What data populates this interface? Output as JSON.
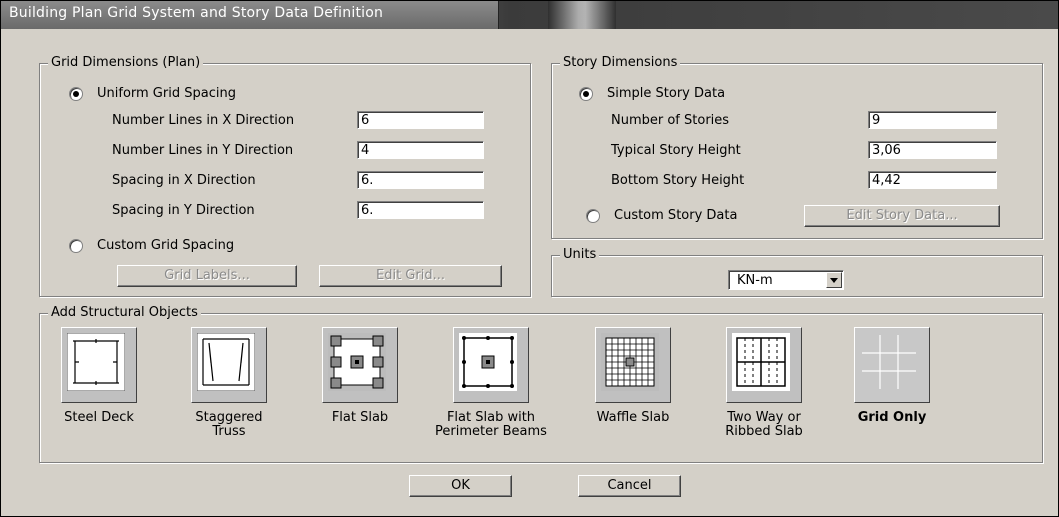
{
  "window": {
    "title": "Building Plan Grid System and Story Data Definition"
  },
  "grid": {
    "group_title": "Grid Dimensions (Plan)",
    "uniform_label": "Uniform Grid Spacing",
    "uniform_selected": true,
    "lines_x_label": "Number Lines in X Direction",
    "lines_x_value": "6",
    "lines_y_label": "Number Lines in Y Direction",
    "lines_y_value": "4",
    "spacing_x_label": "Spacing in X Direction",
    "spacing_x_value": "6.",
    "spacing_y_label": "Spacing in Y Direction",
    "spacing_y_value": "6.",
    "custom_label": "Custom Grid Spacing",
    "grid_labels_button": "Grid Labels...",
    "edit_grid_button": "Edit Grid..."
  },
  "story": {
    "group_title": "Story Dimensions",
    "simple_label": "Simple Story Data",
    "simple_selected": true,
    "num_stories_label": "Number of Stories",
    "num_stories_value": "9",
    "typical_height_label": "Typical Story Height",
    "typical_height_value": "3,06",
    "bottom_height_label": "Bottom Story Height",
    "bottom_height_value": "4,42",
    "custom_label": "Custom Story Data",
    "edit_story_button": "Edit Story Data..."
  },
  "units": {
    "group_title": "Units",
    "selected": "KN-m"
  },
  "structural": {
    "group_title": "Add Structural Objects",
    "tiles": [
      {
        "label": "Steel Deck",
        "icon": "steel-deck-icon"
      },
      {
        "label": "Staggered Truss",
        "icon": "staggered-truss-icon"
      },
      {
        "label": "Flat Slab",
        "icon": "flat-slab-icon"
      },
      {
        "label": "Flat Slab with Perimeter Beams",
        "icon": "flat-slab-perimeter-icon"
      },
      {
        "label": "Waffle Slab",
        "icon": "waffle-slab-icon"
      },
      {
        "label": "Two Way or Ribbed Slab",
        "icon": "ribbed-slab-icon"
      },
      {
        "label": "Grid Only",
        "icon": "grid-only-icon"
      }
    ]
  },
  "buttons": {
    "ok": "OK",
    "cancel": "Cancel"
  }
}
